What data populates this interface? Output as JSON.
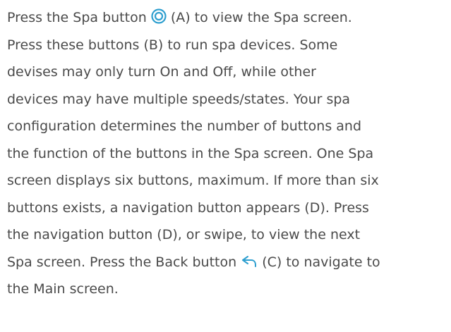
{
  "document": {
    "accent_color": "#2e9fcf",
    "icons": {
      "spa": "spa-button-icon",
      "back": "back-arrow-icon"
    },
    "lines": [
      {
        "before": "Press the Spa button ",
        "after": " (A) to view the Spa screen."
      },
      {
        "text": "Press these buttons (B) to run spa devices. Some"
      },
      {
        "text": "devises may only turn On and Off, while other"
      },
      {
        "text": "devices may have multiple speeds/states. Your spa"
      },
      {
        "text": "configuration determines the number of buttons and"
      },
      {
        "text": "the function of the buttons in the Spa screen. One Spa"
      },
      {
        "text": "screen displays six buttons, maximum. If more than six"
      },
      {
        "text": "buttons exists, a navigation button appears (D). Press"
      },
      {
        "text": "the navigation button (D), or swipe, to view the next"
      },
      {
        "before": "Spa screen. Press the Back button ",
        "after": " (C) to navigate to"
      },
      {
        "text": "the Main screen."
      }
    ]
  }
}
